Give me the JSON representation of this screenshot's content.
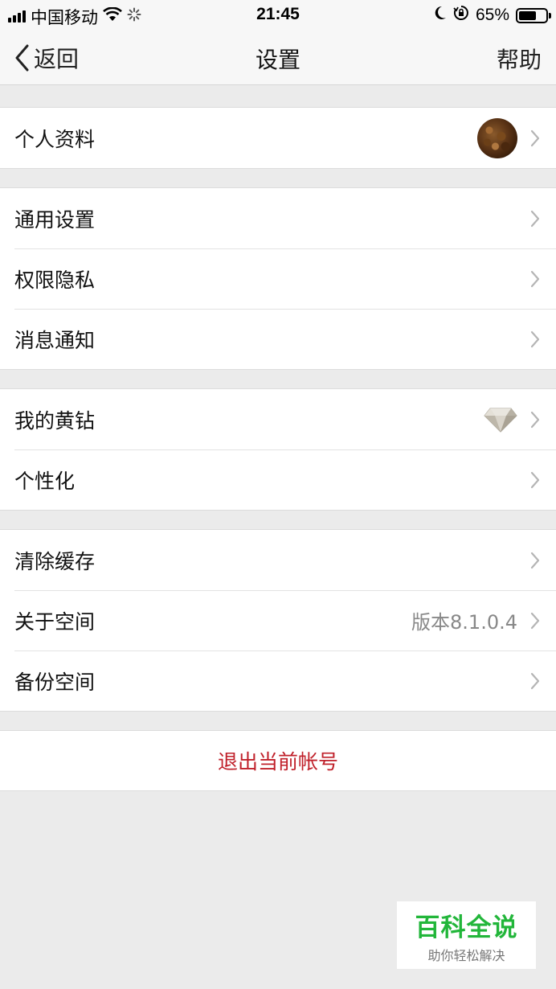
{
  "status_bar": {
    "carrier": "中国移动",
    "time": "21:45",
    "battery": "65%",
    "battery_level": 0.65,
    "icons": [
      "signal-icon",
      "wifi-icon",
      "activity-spinner-icon",
      "moon-icon",
      "orientation-lock-icon",
      "battery-icon"
    ]
  },
  "nav": {
    "back_label": "返回",
    "title": "设置",
    "help_label": "帮助"
  },
  "groups": [
    {
      "items": [
        {
          "label": "个人资料",
          "accessory": "avatar"
        }
      ]
    },
    {
      "items": [
        {
          "label": "通用设置"
        },
        {
          "label": "权限隐私"
        },
        {
          "label": "消息通知"
        }
      ]
    },
    {
      "items": [
        {
          "label": "我的黄钻",
          "accessory": "diamond-icon"
        },
        {
          "label": "个性化"
        }
      ]
    },
    {
      "items": [
        {
          "label": "清除缓存"
        },
        {
          "label": "关于空间",
          "value": "版本8.1.0.4"
        },
        {
          "label": "备份空间"
        }
      ]
    }
  ],
  "logout_label": "退出当前帐号",
  "watermark": {
    "title": "百科全说",
    "subtitle": "助你轻松解决"
  },
  "colors": {
    "background": "#ebebeb",
    "logout_text": "#c0202a",
    "watermark_green": "#22b63a",
    "chevron": "#b5b5b5"
  }
}
